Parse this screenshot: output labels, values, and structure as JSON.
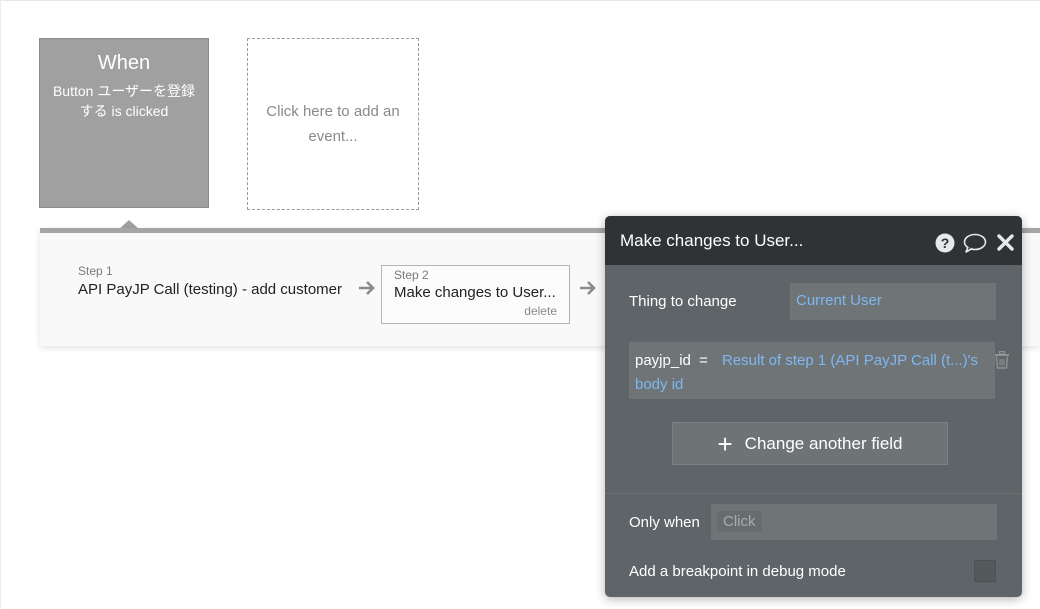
{
  "trigger": {
    "title": "When",
    "description": "Button ユーザーを登録する is clicked"
  },
  "add_event": {
    "label": "Click here to add an event..."
  },
  "steps": [
    {
      "label": "Step 1",
      "title": "API PayJP Call (testing) - add customer"
    },
    {
      "label": "Step 2",
      "title": "Make changes to User...",
      "delete_label": "delete"
    }
  ],
  "panel": {
    "title": "Make changes to User...",
    "icons": [
      "help-icon",
      "comment-icon",
      "close-icon"
    ],
    "thing_to_change": {
      "label": "Thing to change",
      "value": "Current User"
    },
    "fields": [
      {
        "name": "payjp_id",
        "operator": "=",
        "value": "Result of step 1 (API PayJP Call (t...)'s body id"
      }
    ],
    "change_another_field_label": "Change another field",
    "only_when": {
      "label": "Only when",
      "placeholder": "Click"
    },
    "breakpoint": {
      "label": "Add a breakpoint in debug mode",
      "checked": false
    }
  },
  "colors": {
    "panel_bg": "#5f6468",
    "panel_header_bg": "#2f3336",
    "link_blue": "#7fb7f2",
    "trigger_bg": "#a0a0a0"
  }
}
